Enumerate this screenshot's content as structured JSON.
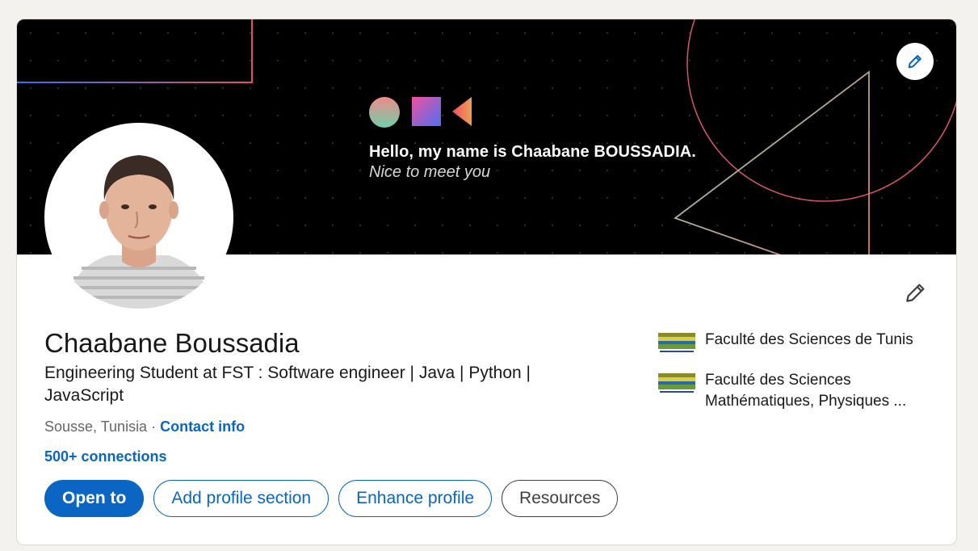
{
  "banner": {
    "greeting": "Hello, my name is Chaabane BOUSSADIA.",
    "subtitle": "Nice to meet you",
    "edit_icon": "pencil-icon"
  },
  "profile": {
    "name": "Chaabane Boussadia",
    "headline": "Engineering Student at FST : Software engineer | Java | Python | JavaScript",
    "location": "Sousse, Tunisia",
    "separator": " · ",
    "contact_label": "Contact info",
    "connections": "500+ connections",
    "edit_icon": "pencil-icon"
  },
  "actions": {
    "open_to": "Open to",
    "add_section": "Add profile section",
    "enhance": "Enhance profile",
    "resources": "Resources"
  },
  "education": [
    {
      "name": "Faculté des Sciences de Tunis"
    },
    {
      "name": "Faculté des Sciences Mathématiques, Physiques ..."
    }
  ],
  "colors": {
    "accent": "#0a66c2",
    "banner_bg": "#000000",
    "page_bg": "#f4f2ee"
  }
}
